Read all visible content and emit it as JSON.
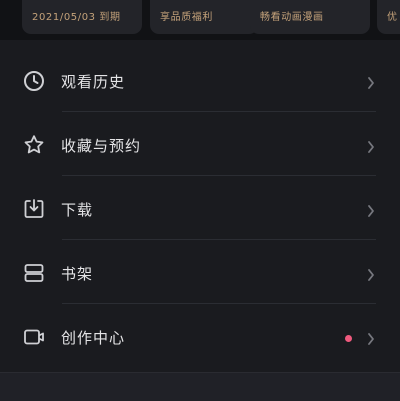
{
  "colors": {
    "background": "#1a1b1f",
    "gold_title": "#caa15f",
    "gold_sub": "#c4a27a",
    "text": "#e4e4e6",
    "icon": "#cfd0d4",
    "chevron": "#77787f",
    "badge": "#f05a7e"
  },
  "top_cards": [
    {
      "title": "",
      "subtitle": "2021/05/03 到期"
    },
    {
      "title": "",
      "subtitle": "享品质福利"
    },
    {
      "title": "",
      "subtitle": "畅看动画漫画"
    },
    {
      "title": "",
      "subtitle": "优"
    }
  ],
  "menu": {
    "items": [
      {
        "label": "观看历史",
        "icon": "clock-icon"
      },
      {
        "label": "收藏与预约",
        "icon": "star-icon"
      },
      {
        "label": "下载",
        "icon": "download-icon"
      },
      {
        "label": "书架",
        "icon": "bookshelf-icon"
      },
      {
        "label": "创作中心",
        "icon": "video-camera-icon",
        "has_badge": true
      }
    ]
  }
}
